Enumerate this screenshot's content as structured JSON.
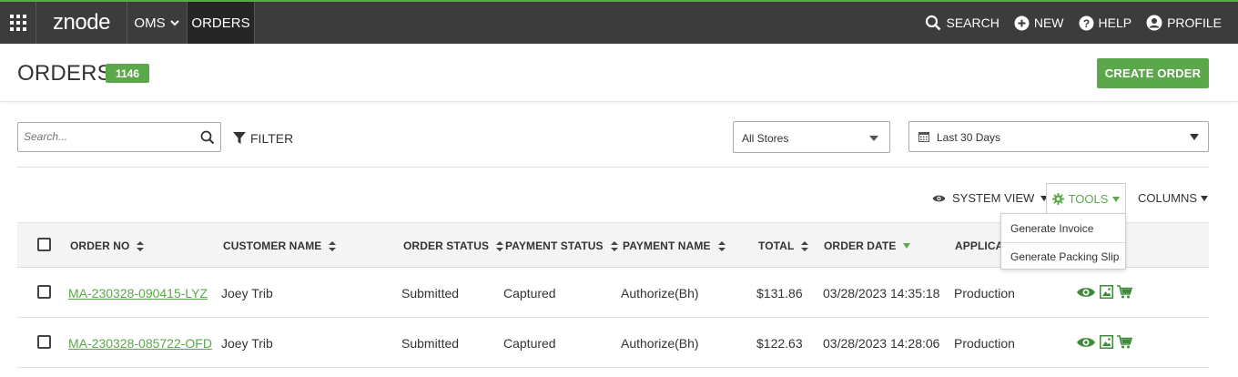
{
  "nav": {
    "logo": "znode",
    "oms_label": "OMS",
    "orders_label": "ORDERS",
    "search_label": "SEARCH",
    "new_label": "NEW",
    "help_label": "HELP",
    "profile_label": "PROFILE"
  },
  "header": {
    "title": "ORDERS",
    "count": "1146",
    "create_label": "CREATE ORDER"
  },
  "filters": {
    "search_placeholder": "Search...",
    "filter_label": "FILTER",
    "store_value": "All Stores",
    "date_value": "Last 30 Days"
  },
  "toolbar": {
    "system_view_label": "SYSTEM VIEW",
    "tools_label": "TOOLS",
    "columns_label": "COLUMNS",
    "tools_menu": [
      "Generate Invoice",
      "Generate Packing Slip"
    ]
  },
  "table": {
    "headers": {
      "order_no": "ORDER NO",
      "customer_name": "CUSTOMER NAME",
      "order_status": "ORDER STATUS",
      "payment_status": "PAYMENT STATUS",
      "payment_name": "PAYMENT NAME",
      "total": "TOTAL",
      "order_date": "ORDER DATE",
      "application": "APPLICAT"
    },
    "rows": [
      {
        "order_no": "MA-230328-090415-LYZ",
        "customer_name": "Joey Trib",
        "order_status": "Submitted",
        "payment_status": "Captured",
        "payment_name": "Authorize(Bh)",
        "total": "$131.86",
        "order_date": "03/28/2023 14:35:18",
        "application": "Production"
      },
      {
        "order_no": "MA-230328-085722-OFD",
        "customer_name": "Joey Trib",
        "order_status": "Submitted",
        "payment_status": "Captured",
        "payment_name": "Authorize(Bh)",
        "total": "$122.63",
        "order_date": "03/28/2023 14:28:06",
        "application": "Production"
      }
    ]
  },
  "colors": {
    "brand_green": "#5ba84a",
    "nav_bg": "#3c3c3c",
    "nav_active_bg": "#262626"
  },
  "icons": {
    "apps": "grid-icon",
    "search": "search-icon",
    "new": "plus-circle-icon",
    "help": "question-circle-icon",
    "profile": "user-circle-icon",
    "filter": "funnel-icon",
    "calendar": "calendar-icon",
    "view": "eye-icon",
    "tools": "gear-icon",
    "row_view": "eye-icon",
    "row_image": "image-icon",
    "row_cart": "cart-icon"
  }
}
